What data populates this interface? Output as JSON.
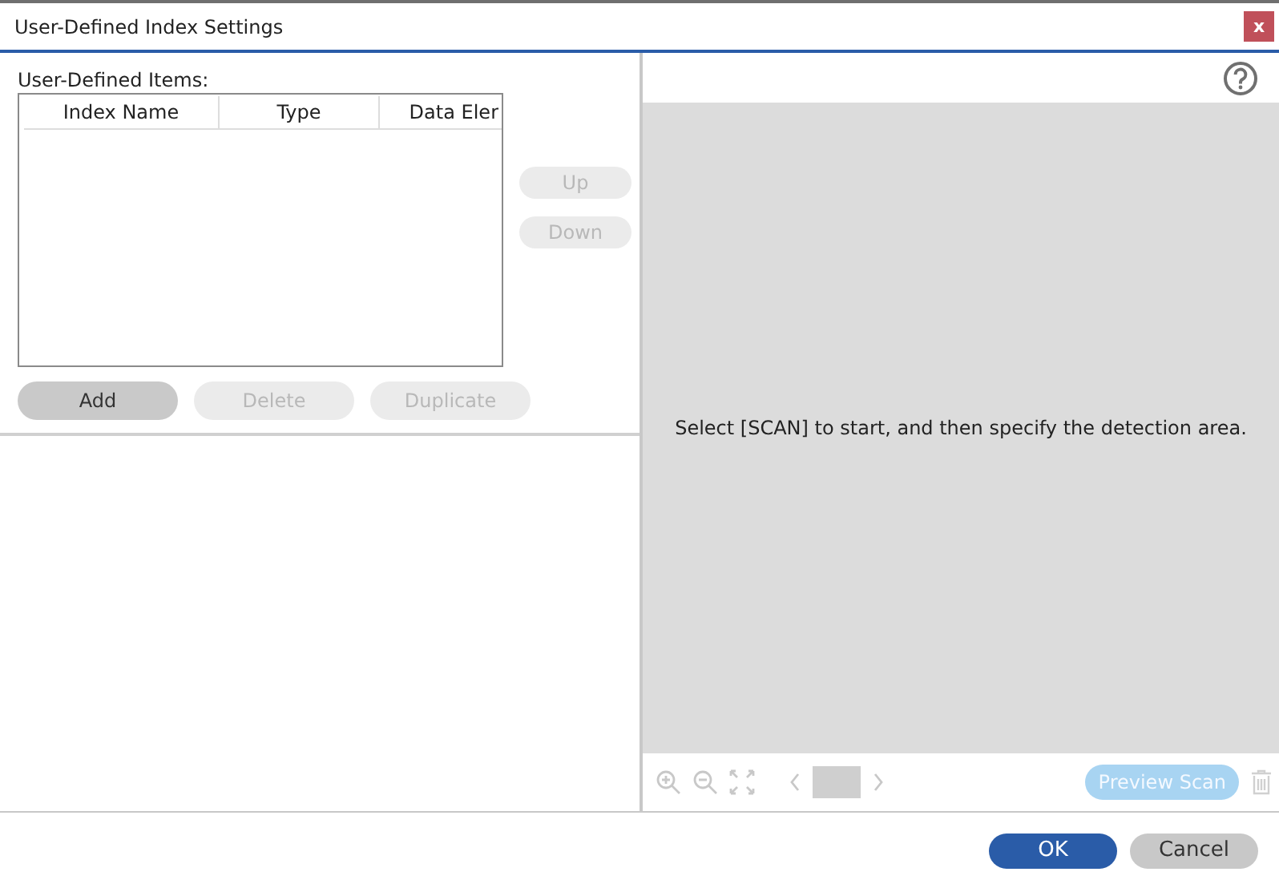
{
  "window": {
    "title": "User-Defined Index Settings",
    "close": "x"
  },
  "items_label": "User-Defined Items:",
  "table": {
    "columns": [
      "Index Name",
      "Type",
      "Data Eler"
    ]
  },
  "side_buttons": [
    {
      "label": "Up",
      "disabled": true
    },
    {
      "label": "Down",
      "disabled": true
    }
  ],
  "item_buttons": [
    {
      "label": "Add",
      "disabled": false
    },
    {
      "label": "Delete",
      "disabled": true
    },
    {
      "label": "Duplicate",
      "disabled": true
    }
  ],
  "preview": {
    "message": "Select [SCAN] to start, and then specify the detection area.",
    "preview_button": {
      "label": "Preview Scan",
      "disabled": true
    }
  },
  "dialog_buttons": [
    {
      "label": "OK",
      "kind": "primary"
    },
    {
      "label": "Cancel",
      "kind": "secondary"
    }
  ]
}
